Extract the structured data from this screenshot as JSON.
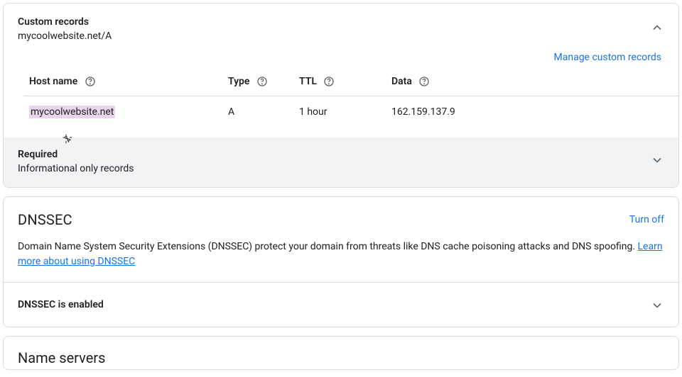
{
  "custom_records": {
    "title": "Custom records",
    "subtitle": "mycoolwebsite.net/A",
    "manage_label": "Manage custom records",
    "columns": {
      "host": "Host name",
      "type": "Type",
      "ttl": "TTL",
      "data": "Data"
    },
    "rows": [
      {
        "host": "mycoolwebsite.net",
        "type": "A",
        "ttl": "1 hour",
        "data": "162.159.137.9"
      }
    ]
  },
  "required_section": {
    "title": "Required",
    "subtitle": "Informational only records"
  },
  "dnssec": {
    "title": "DNSSEC",
    "turn_off_label": "Turn off",
    "desc_prefix": "Domain Name System Security Extensions (DNSSEC) protect your domain from threats like DNS cache poisoning attacks and DNS spoofing. ",
    "learn_more_label": "Learn more about using DNSSEC",
    "enabled_label": "DNSSEC is enabled"
  },
  "name_servers": {
    "title": "Name servers"
  }
}
